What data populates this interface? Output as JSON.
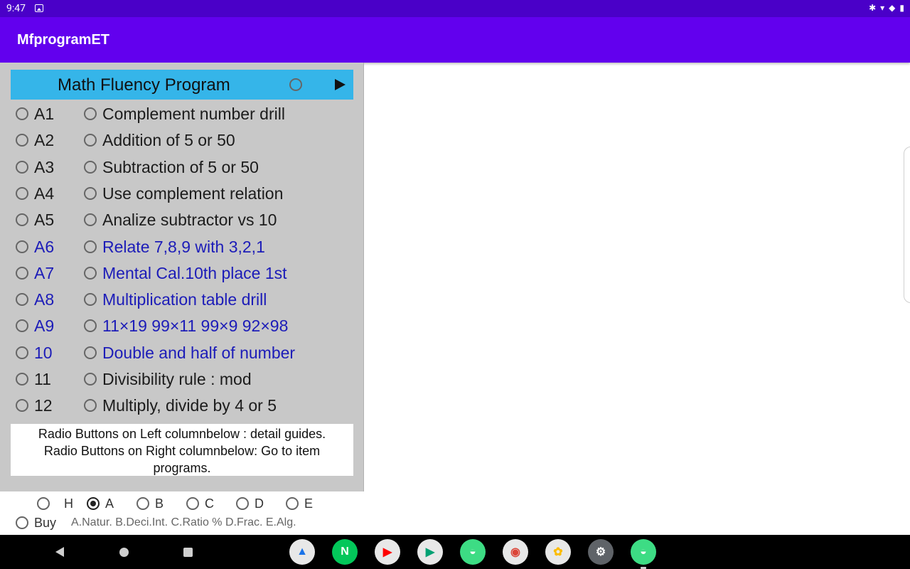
{
  "status_bar": {
    "time": "9:47"
  },
  "app_bar": {
    "title": "MfprogramET"
  },
  "header": {
    "title": "Math Fluency Program"
  },
  "items": [
    {
      "code": "A1",
      "label": "Complement number drill",
      "color": "black"
    },
    {
      "code": "A2",
      "label": "Addition of 5 or 50",
      "color": "black"
    },
    {
      "code": "A3",
      "label": "Subtraction of 5 or 50",
      "color": "black"
    },
    {
      "code": "A4",
      "label": "Use complement relation",
      "color": "black"
    },
    {
      "code": "A5",
      "label": "Analize subtractor vs 10",
      "color": "black"
    },
    {
      "code": "A6",
      "label": "Relate 7,8,9 with 3,2,1",
      "color": "blue"
    },
    {
      "code": "A7",
      "label": "Mental Cal.10th place 1st",
      "color": "blue"
    },
    {
      "code": "A8",
      "label": "Multiplication table drill",
      "color": "blue"
    },
    {
      "code": "A9",
      "label": "11×19 99×11 99×9 92×98",
      "color": "blue"
    },
    {
      "code": "10",
      "label": "Double and half of number",
      "color": "blue"
    },
    {
      "code": "11",
      "label": "Divisibility rule : mod",
      "color": "black"
    },
    {
      "code": "12",
      "label": "Multiply, divide by 4 or 5",
      "color": "black"
    }
  ],
  "note": {
    "line1": "Radio Buttons on Left columnbelow : detail guides.",
    "line2": "Radio Buttons on Right columnbelow: Go to item",
    "line3": "programs."
  },
  "categories": [
    {
      "label": "H",
      "checked": false
    },
    {
      "label": "A",
      "checked": true
    },
    {
      "label": "B",
      "checked": false
    },
    {
      "label": "C",
      "checked": false
    },
    {
      "label": "D",
      "checked": false
    },
    {
      "label": "E",
      "checked": false
    }
  ],
  "buy": {
    "label": "Buy"
  },
  "legend": "A.Natur. B.Deci.Int. C.Ratio % D.Frac. E.Alg.",
  "dock_apps": [
    {
      "name": "Drive",
      "icon": "drive-icon",
      "bg": "#e8e8e8",
      "fg": "#1a73e8",
      "glyph": "▲"
    },
    {
      "name": "Naver",
      "icon": "naver-icon",
      "bg": "#03c75a",
      "fg": "#ffffff",
      "glyph": "N"
    },
    {
      "name": "YouTube",
      "icon": "youtube-icon",
      "bg": "#e8e8e8",
      "fg": "#ff0000",
      "glyph": "▶"
    },
    {
      "name": "Play Store",
      "icon": "play-store-icon",
      "bg": "#e8e8e8",
      "fg": "#00a173",
      "glyph": "▶"
    },
    {
      "name": "Android App",
      "icon": "android-icon",
      "bg": "#3ddc84",
      "fg": "#ffffff",
      "glyph": "◒"
    },
    {
      "name": "Chrome",
      "icon": "chrome-icon",
      "bg": "#e8e8e8",
      "fg": "#db4437",
      "glyph": "◉"
    },
    {
      "name": "Photos",
      "icon": "photos-icon",
      "bg": "#e8e8e8",
      "fg": "#fbbc04",
      "glyph": "✿"
    },
    {
      "name": "Settings",
      "icon": "settings-icon",
      "bg": "#5f6368",
      "fg": "#ffffff",
      "glyph": "⚙"
    },
    {
      "name": "Android App 2",
      "icon": "android-icon",
      "bg": "#3ddc84",
      "fg": "#ffffff",
      "glyph": "◒"
    }
  ]
}
